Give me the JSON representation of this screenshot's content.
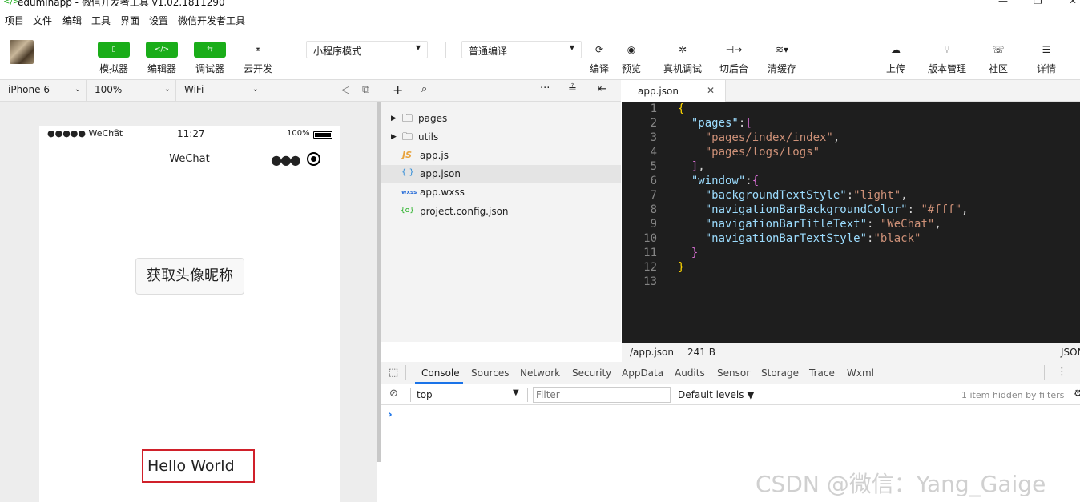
{
  "window": {
    "title": "eduminapp - 微信开发者工具 v1.02.1811290"
  },
  "menu": [
    "项目",
    "文件",
    "编辑",
    "工具",
    "界面",
    "设置",
    "微信开发者工具"
  ],
  "toolbar": {
    "green_buttons": [
      {
        "icon": "phone-icon",
        "glyph": "▯",
        "label": "模拟器"
      },
      {
        "icon": "code-icon",
        "glyph": "</>",
        "label": "编辑器"
      },
      {
        "icon": "debug-icon",
        "glyph": "⇆",
        "label": "调试器"
      }
    ],
    "cloud_label": "云开发",
    "mode_select": "小程序模式",
    "compile_select": "普通编译",
    "actions": [
      {
        "icon": "refresh-icon",
        "glyph": "⟳",
        "label": "编译"
      },
      {
        "icon": "eye-icon",
        "glyph": "◉",
        "label": "预览"
      },
      {
        "icon": "bug-icon",
        "glyph": "✲",
        "label": "真机调试"
      },
      {
        "icon": "switch-backend-icon",
        "glyph": "⊣→",
        "label": "切后台"
      },
      {
        "icon": "layers-icon",
        "glyph": "≋▾",
        "label": "清缓存"
      }
    ],
    "right_actions": [
      {
        "icon": "upload-cloud-icon",
        "glyph": "☁",
        "label": "上传"
      },
      {
        "icon": "branch-icon",
        "glyph": "⑂",
        "label": "版本管理"
      },
      {
        "icon": "chat-bubble-icon",
        "glyph": "☏",
        "label": "社区"
      },
      {
        "icon": "menu-lines-icon",
        "glyph": "☰",
        "label": "详情"
      }
    ]
  },
  "simulator": {
    "device": "iPhone 6",
    "zoom": "100%",
    "network": "WiFi",
    "status_carrier": "●●●●● WeChat",
    "status_time": "11:27",
    "status_battery": "100%",
    "nav_title": "WeChat",
    "button_label": "获取头像昵称",
    "hello_text": "Hello World"
  },
  "files": [
    {
      "type": "folder",
      "name": "pages"
    },
    {
      "type": "folder",
      "name": "utils"
    },
    {
      "type": "js",
      "badge": "JS",
      "name": "app.js"
    },
    {
      "type": "json",
      "badge": "{ }",
      "name": "app.json",
      "selected": true
    },
    {
      "type": "wxss",
      "badge": "wxss",
      "name": "app.wxss"
    },
    {
      "type": "config",
      "badge": "{o}",
      "name": "project.config.json"
    }
  ],
  "editor": {
    "tab": "app.json",
    "line_numbers": [
      "1",
      "2",
      "3",
      "4",
      "5",
      "6",
      "7",
      "8",
      "9",
      "10",
      "11",
      "12",
      "13"
    ],
    "status_path": "/app.json",
    "status_size": "241 B",
    "status_lang": "JSON"
  },
  "devtools": {
    "tabs": [
      "Console",
      "Sources",
      "Network",
      "Security",
      "AppData",
      "Audits",
      "Sensor",
      "Storage",
      "Trace",
      "Wxml"
    ],
    "active_tab": "Console",
    "context": "top",
    "filter_placeholder": "Filter",
    "levels": "Default levels ▼",
    "hidden_note": "1 item hidden by filters",
    "prompt": "›"
  },
  "watermark": "CSDN @微信：Yang_Gaige"
}
